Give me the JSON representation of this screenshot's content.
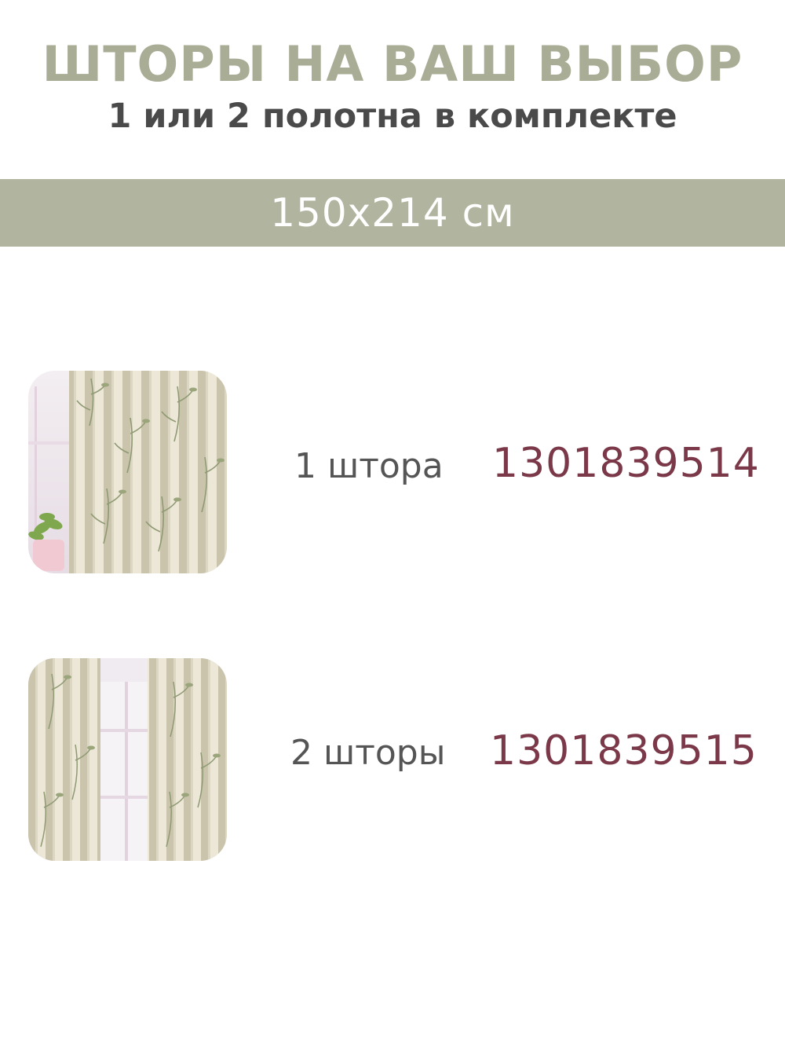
{
  "header": {
    "title": "ШТОРЫ НА ВАШ ВЫБОР",
    "subtitle": "1 или 2 полотна в комплекте"
  },
  "size_band": {
    "text": "150x214 см"
  },
  "options": [
    {
      "label": "1 штора",
      "code": "1301839514"
    },
    {
      "label": "2 шторы",
      "code": "1301839515"
    }
  ],
  "colors": {
    "accent_sage": "#b1b49f",
    "title_sage": "#a9ad95",
    "code_burgundy": "#7a3848",
    "text_dark": "#4a4a4a"
  }
}
